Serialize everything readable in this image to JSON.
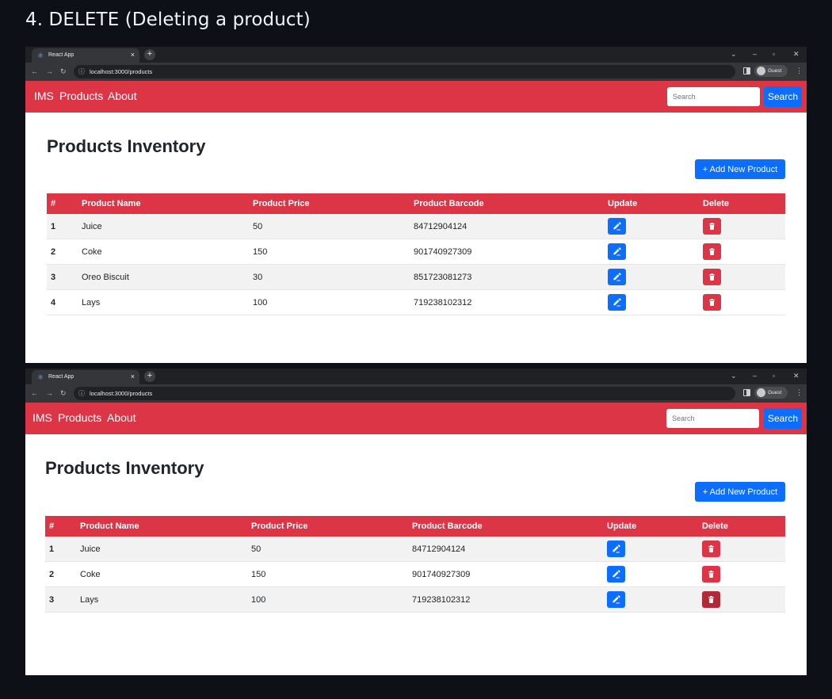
{
  "heading": "4. DELETE (Deleting a product)",
  "colors": {
    "navbar": "#dc3545",
    "primary": "#0d6efd",
    "danger": "#dc3545",
    "table_header": "#dc3545"
  },
  "browser": {
    "tab_title": "React App",
    "url": "localhost:3000/products",
    "profile_label": "Guest",
    "favicon": "react-icon"
  },
  "navbar": {
    "brand": "IMS",
    "products": "Products",
    "about": "About",
    "search_placeholder": "Search",
    "search_button": "Search"
  },
  "page": {
    "title": "Products Inventory",
    "add_button": "+ Add New Product"
  },
  "table": {
    "headers": [
      "#",
      "Product Name",
      "Product Price",
      "Product Barcode",
      "Update",
      "Delete"
    ]
  },
  "before": {
    "rows": [
      {
        "num": "1",
        "name": "Juice",
        "price": "50",
        "barcode": "84712904124"
      },
      {
        "num": "2",
        "name": "Coke",
        "price": "150",
        "barcode": "901740927309"
      },
      {
        "num": "3",
        "name": "Oreo Biscuit",
        "price": "30",
        "barcode": "851723081273"
      },
      {
        "num": "4",
        "name": "Lays",
        "price": "100",
        "barcode": "719238102312"
      }
    ]
  },
  "after": {
    "rows": [
      {
        "num": "1",
        "name": "Juice",
        "price": "50",
        "barcode": "84712904124"
      },
      {
        "num": "2",
        "name": "Coke",
        "price": "150",
        "barcode": "901740927309"
      },
      {
        "num": "3",
        "name": "Lays",
        "price": "100",
        "barcode": "719238102312"
      }
    ]
  }
}
